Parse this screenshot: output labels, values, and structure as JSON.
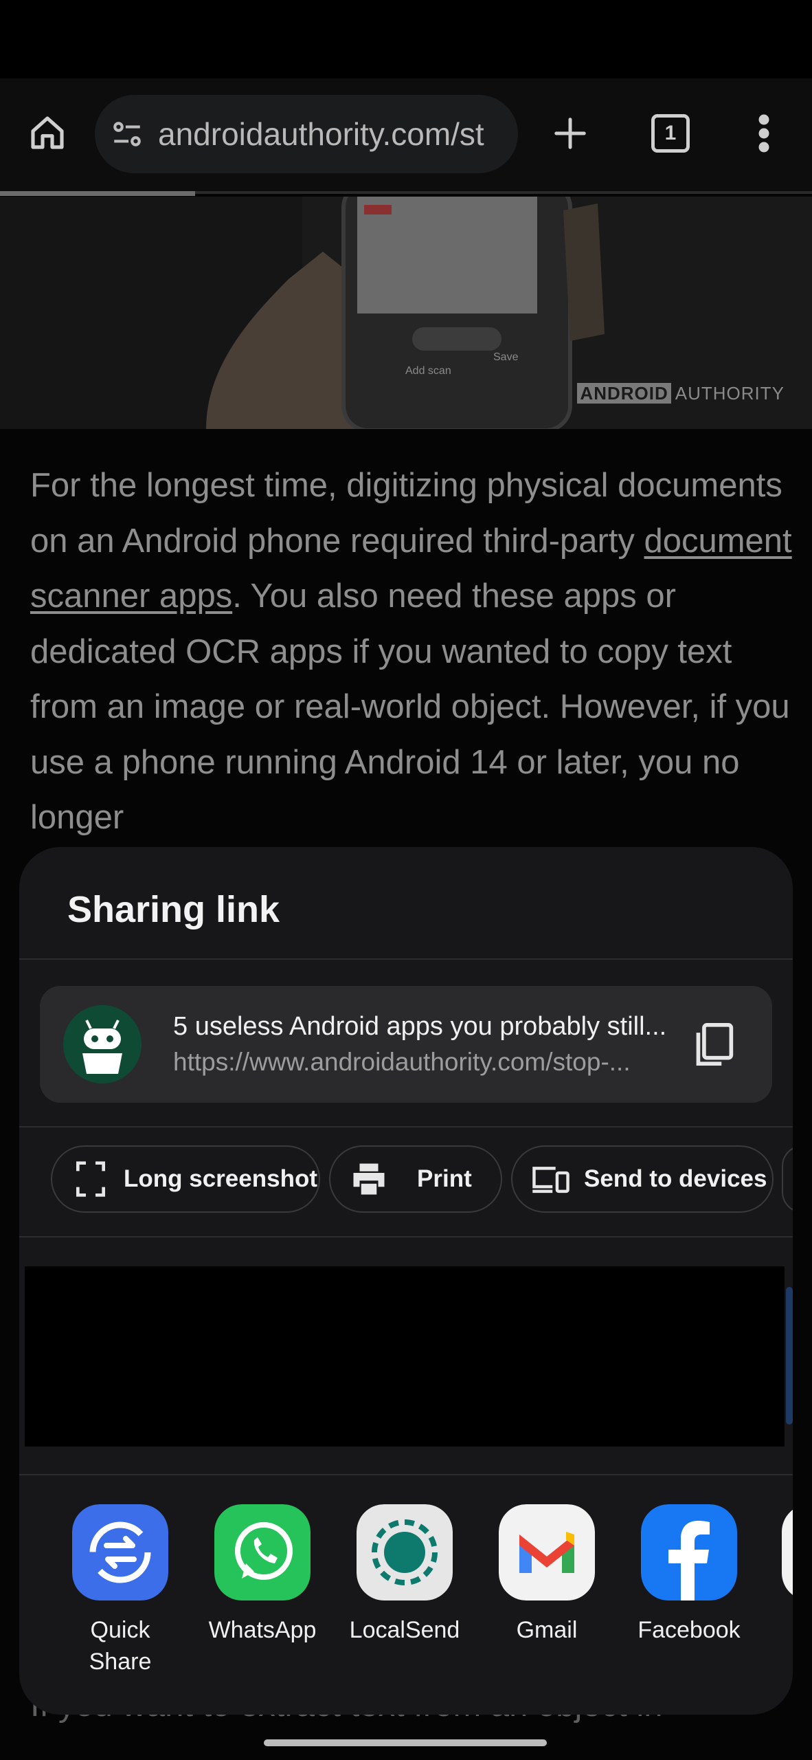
{
  "browser": {
    "url": "androidauthority.com/st",
    "tab_count": "1",
    "progress_fraction": 0.24
  },
  "hero": {
    "watermark_brand": "ANDROID",
    "watermark_word": "AUTHORITY"
  },
  "article": {
    "text_before_link": "For the longest time, digitizing physical documents on an Android phone required third-party ",
    "link_text": "document scanner apps",
    "text_after_link": ". You also need these apps or dedicated OCR apps if you wanted to copy text from an image or real-world object. However, if you use a phone running Android 14 or later, you no longer",
    "next_paragraph_peek": "If you want to extract text from an object in"
  },
  "share_sheet": {
    "title": "Sharing link",
    "link": {
      "title": "5 useless Android apps you probably still...",
      "url": "https://www.androidauthority.com/stop-..."
    },
    "actions": [
      {
        "label": "Long screenshot",
        "icon": "long-screenshot-icon"
      },
      {
        "label": "Print",
        "icon": "printer-icon"
      },
      {
        "label": "Send to devices",
        "icon": "devices-icon"
      }
    ],
    "apps": [
      {
        "label": "Quick Share",
        "icon": "quick-share-icon",
        "color": "#3b6ee8"
      },
      {
        "label": "WhatsApp",
        "icon": "whatsapp-icon",
        "color": "#25c35a"
      },
      {
        "label": "LocalSend",
        "icon": "localsend-icon",
        "color": "#e6e6e6"
      },
      {
        "label": "Gmail",
        "icon": "gmail-icon",
        "color": "#f2f2f2"
      },
      {
        "label": "Facebook",
        "icon": "facebook-icon",
        "color": "#1877f2"
      }
    ]
  }
}
